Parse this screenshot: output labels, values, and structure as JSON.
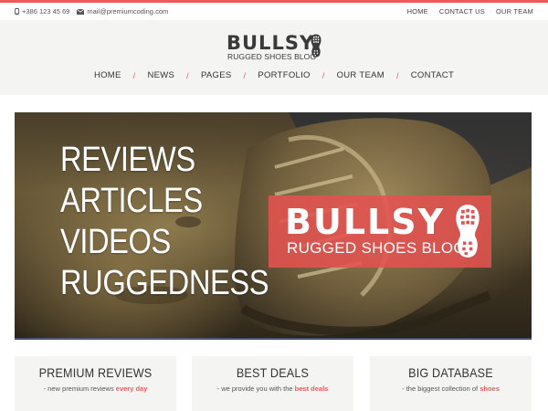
{
  "topbar": {
    "phone": "+386 123 45 69",
    "email": "mail@premiumcoding.com",
    "links": [
      "HOME",
      "CONTACT US",
      "OUR TEAM"
    ]
  },
  "logo": {
    "brand": "BULLSY",
    "tagline": "RUGGED SHOES BLOG"
  },
  "nav": {
    "items": [
      "HOME",
      "NEWS",
      "PAGES",
      "PORTFOLIO",
      "OUR TEAM",
      "CONTACT"
    ],
    "separator": "/"
  },
  "hero": {
    "words": [
      "REVIEWS",
      "ARTICLES",
      "VIDEOS",
      "RUGGEDNESS"
    ],
    "badge_brand": "BULLSY",
    "badge_tagline": "RUGGED SHOES BLOG"
  },
  "features": [
    {
      "title": "PREMIUM REVIEWS",
      "sub_prefix": "- new premium reviews ",
      "sub_highlight": "every day"
    },
    {
      "title": "BEST DEALS",
      "sub_prefix": "- we provide you with the ",
      "sub_highlight": "best deals"
    },
    {
      "title": "BIG DATABASE",
      "sub_prefix": "- the biggest collection of ",
      "sub_highlight": "shoes"
    }
  ],
  "colors": {
    "accent": "#f0595b",
    "header_bg": "#f4f4f2",
    "text": "#333333"
  },
  "icons": {
    "phone": "phone-icon",
    "email": "envelope-icon",
    "boot": "boot-sole-icon"
  }
}
